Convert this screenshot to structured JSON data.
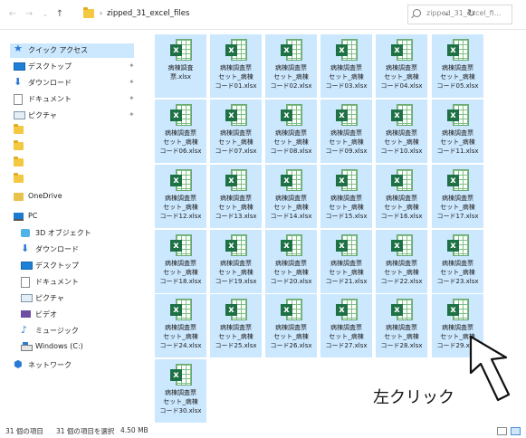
{
  "address_bar": {
    "back_icon": "←",
    "forward_icon": "→",
    "recent_icon": "⌄",
    "up_icon": "↑",
    "breadcrumb_chevron": "›",
    "path": "zipped_31_excel_files",
    "dropdown_icon": "⌄",
    "refresh_icon": "↻",
    "search_placeholder": "zipped_31_excel_fi..."
  },
  "sidebar": {
    "items": [
      {
        "label": "クイック アクセス",
        "icon": "star-icon",
        "selected": true
      },
      {
        "label": "デスクトップ",
        "icon": "desktop-icon",
        "pinned": true
      },
      {
        "label": "ダウンロード",
        "icon": "download-icon",
        "pinned": true
      },
      {
        "label": "ドキュメント",
        "icon": "document-icon",
        "pinned": true
      },
      {
        "label": "ピクチャ",
        "icon": "pictures-icon",
        "pinned": true
      },
      {
        "label": "",
        "icon": "folder-icon"
      },
      {
        "label": "",
        "icon": "folder-icon"
      },
      {
        "label": "",
        "icon": "folder-icon"
      },
      {
        "label": "",
        "icon": "folder-icon"
      },
      {
        "label": "OneDrive",
        "icon": "onedrive-icon"
      },
      {
        "label": "PC",
        "icon": "pc-icon"
      },
      {
        "label": "3D オブジェクト",
        "icon": "3d-objects-icon"
      },
      {
        "label": "ダウンロード",
        "icon": "download-icon"
      },
      {
        "label": "デスクトップ",
        "icon": "desktop-icon"
      },
      {
        "label": "ドキュメント",
        "icon": "document-icon"
      },
      {
        "label": "ピクチャ",
        "icon": "pictures-icon"
      },
      {
        "label": "ビデオ",
        "icon": "video-icon"
      },
      {
        "label": "ミュージック",
        "icon": "music-icon"
      },
      {
        "label": "Windows (C:)",
        "icon": "drive-icon"
      },
      {
        "label": "ネットワーク",
        "icon": "network-icon"
      }
    ],
    "pin_icon": "✦"
  },
  "files": [
    {
      "lines": [
        "病棟調査",
        "票.xlsx"
      ]
    },
    {
      "lines": [
        "病棟調査票",
        "セット_病棟",
        "コード01.xlsx"
      ]
    },
    {
      "lines": [
        "病棟調査票",
        "セット_病棟",
        "コード02.xlsx"
      ]
    },
    {
      "lines": [
        "病棟調査票",
        "セット_病棟",
        "コード03.xlsx"
      ]
    },
    {
      "lines": [
        "病棟調査票",
        "セット_病棟",
        "コード04.xlsx"
      ]
    },
    {
      "lines": [
        "病棟調査票",
        "セット_病棟",
        "コード05.xlsx"
      ]
    },
    {
      "lines": [
        "病棟調査票",
        "セット_病棟",
        "コード06.xlsx"
      ]
    },
    {
      "lines": [
        "病棟調査票",
        "セット_病棟",
        "コード07.xlsx"
      ]
    },
    {
      "lines": [
        "病棟調査票",
        "セット_病棟",
        "コード08.xlsx"
      ]
    },
    {
      "lines": [
        "病棟調査票",
        "セット_病棟",
        "コード09.xlsx"
      ]
    },
    {
      "lines": [
        "病棟調査票",
        "セット_病棟",
        "コード10.xlsx"
      ]
    },
    {
      "lines": [
        "病棟調査票",
        "セット_病棟",
        "コード11.xlsx"
      ]
    },
    {
      "lines": [
        "病棟調査票",
        "セット_病棟",
        "コード12.xlsx"
      ]
    },
    {
      "lines": [
        "病棟調査票",
        "セット_病棟",
        "コード13.xlsx"
      ]
    },
    {
      "lines": [
        "病棟調査票",
        "セット_病棟",
        "コード14.xlsx"
      ]
    },
    {
      "lines": [
        "病棟調査票",
        "セット_病棟",
        "コード15.xlsx"
      ]
    },
    {
      "lines": [
        "病棟調査票",
        "セット_病棟",
        "コード16.xlsx"
      ]
    },
    {
      "lines": [
        "病棟調査票",
        "セット_病棟",
        "コード17.xlsx"
      ]
    },
    {
      "lines": [
        "病棟調査票",
        "セット_病棟",
        "コード18.xlsx"
      ]
    },
    {
      "lines": [
        "病棟調査票",
        "セット_病棟",
        "コード19.xlsx"
      ]
    },
    {
      "lines": [
        "病棟調査票",
        "セット_病棟",
        "コード20.xlsx"
      ]
    },
    {
      "lines": [
        "病棟調査票",
        "セット_病棟",
        "コード21.xlsx"
      ]
    },
    {
      "lines": [
        "病棟調査票",
        "セット_病棟",
        "コード22.xlsx"
      ]
    },
    {
      "lines": [
        "病棟調査票",
        "セット_病棟",
        "コード23.xlsx"
      ]
    },
    {
      "lines": [
        "病棟調査票",
        "セット_病棟",
        "コード24.xlsx"
      ]
    },
    {
      "lines": [
        "病棟調査票",
        "セット_病棟",
        "コード25.xlsx"
      ]
    },
    {
      "lines": [
        "病棟調査票",
        "セット_病棟",
        "コード26.xlsx"
      ]
    },
    {
      "lines": [
        "病棟調査票",
        "セット_病棟",
        "コード27.xlsx"
      ]
    },
    {
      "lines": [
        "病棟調査票",
        "セット_病棟",
        "コード28.xlsx"
      ]
    },
    {
      "lines": [
        "病棟調査票",
        "セット_病棟",
        "コード29.xlsx"
      ]
    },
    {
      "lines": [
        "病棟調査票",
        "セット_病棟",
        "コード30.xlsx"
      ]
    }
  ],
  "excel_badge": "x",
  "status_bar": {
    "item_count": "31 個の項目",
    "selection": "31 個の項目を選択",
    "size": "4.50 MB"
  },
  "annotation": {
    "text": "左クリック"
  }
}
